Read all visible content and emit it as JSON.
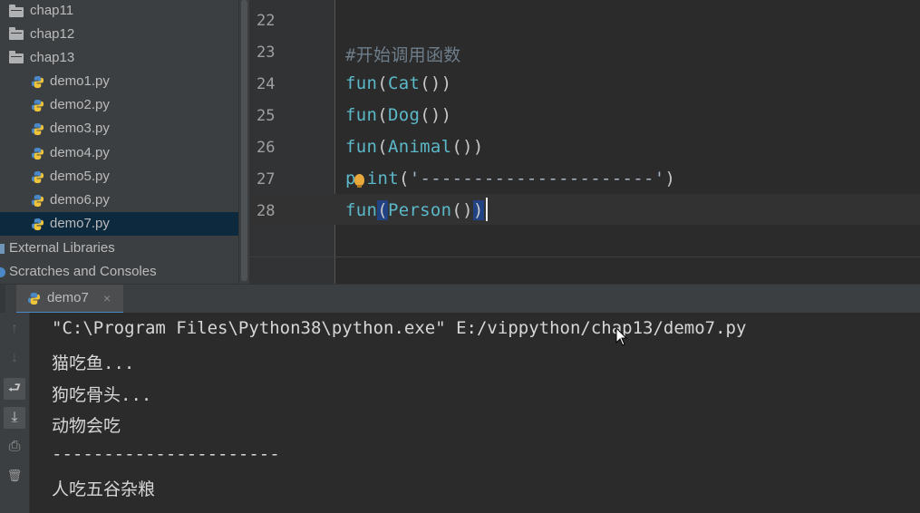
{
  "project_tree": {
    "items": [
      {
        "label": "chap11",
        "type": "folder"
      },
      {
        "label": "chap12",
        "type": "folder"
      },
      {
        "label": "chap13",
        "type": "folder"
      },
      {
        "label": "demo1.py",
        "type": "python-file"
      },
      {
        "label": "demo2.py",
        "type": "python-file"
      },
      {
        "label": "demo3.py",
        "type": "python-file"
      },
      {
        "label": "demo4.py",
        "type": "python-file"
      },
      {
        "label": "demo5.py",
        "type": "python-file"
      },
      {
        "label": "demo6.py",
        "type": "python-file"
      },
      {
        "label": "demo7.py",
        "type": "python-file",
        "selected": true
      },
      {
        "label": "External Libraries",
        "type": "libraries"
      },
      {
        "label": "Scratches and Consoles",
        "type": "scratches"
      }
    ]
  },
  "editor": {
    "line_numbers": [
      "22",
      "23",
      "24",
      "25",
      "26",
      "27",
      "28"
    ],
    "lines": {
      "l23_comment": "#开始调用函数",
      "l24_fn": "fun",
      "l24_open": "(",
      "l24_arg": "Cat",
      "l24_close": "())",
      "l25_fn": "fun",
      "l25_open": "(",
      "l25_arg": "Dog",
      "l25_close": "())",
      "l26_fn": "fun",
      "l26_open": "(",
      "l26_arg": "Animal",
      "l26_close": "())",
      "l27_fn_a": "p",
      "l27_fn_b": "int",
      "l27_open": "(",
      "l27_str": "'----------------------'",
      "l27_close": ")",
      "l28_fn": "fun",
      "l28_open": "(",
      "l28_arg": "Person",
      "l28_mid": "()",
      "l28_close": ")"
    }
  },
  "run_panel": {
    "tab_label": "demo7",
    "tab_close": "×",
    "toolbar": {
      "up_icon": "↑",
      "down_icon": "↓",
      "soft_wrap_icon": "⮐",
      "scroll_end_icon": "⤓",
      "print_icon": "⎙",
      "trash_icon": "🗑"
    },
    "output": [
      "\"C:\\Program Files\\Python38\\python.exe\" E:/vippython/chap13/demo7.py",
      "猫吃鱼...",
      "狗吃骨头...",
      "动物会吃",
      "----------------------",
      "人吃五谷杂粮"
    ]
  },
  "colors": {
    "background": "#2b2b2b",
    "panel": "#3c3f41",
    "selection": "#0d293e",
    "identifier": "#5bb8c8",
    "accent": "#4a88c7"
  }
}
